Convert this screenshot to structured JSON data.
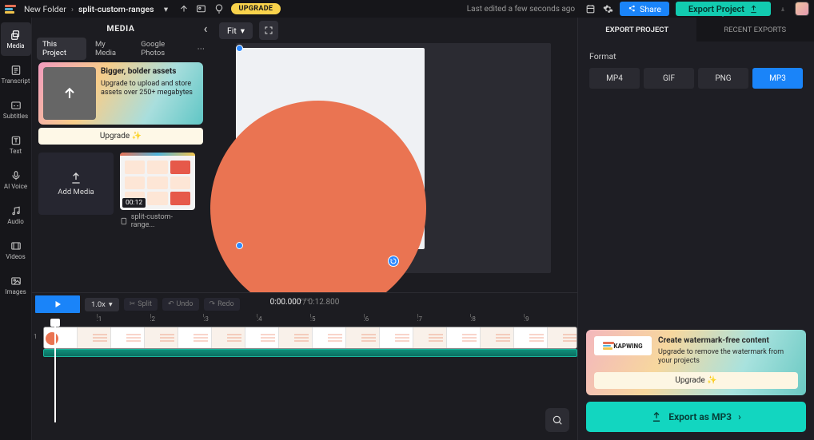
{
  "topbar": {
    "folder": "New Folder",
    "project": "split-custom-ranges",
    "upgrade": "UPGRADE",
    "last_edited": "Last edited a few seconds ago",
    "share": "Share",
    "export": "Export Project"
  },
  "leftnav": {
    "items": [
      {
        "label": "Media",
        "icon": "layers"
      },
      {
        "label": "Transcript",
        "icon": "transcript"
      },
      {
        "label": "Subtitles",
        "icon": "cc"
      },
      {
        "label": "Text",
        "icon": "text"
      },
      {
        "label": "AI Voice",
        "icon": "mic"
      },
      {
        "label": "Audio",
        "icon": "audio"
      },
      {
        "label": "Videos",
        "icon": "video"
      },
      {
        "label": "Images",
        "icon": "image"
      }
    ]
  },
  "media_panel": {
    "title": "MEDIA",
    "tabs": [
      "This Project",
      "My Media",
      "Google Photos"
    ],
    "active_tab": 0,
    "promo": {
      "title": "Bigger, bolder assets",
      "desc": "Upgrade to upload and store assets over 250+ megabytes",
      "cta": "Upgrade ✨"
    },
    "add_media": "Add Media",
    "clip": {
      "duration": "00:12",
      "name": "split-custom-range..."
    }
  },
  "canvas": {
    "fit": "Fit"
  },
  "timeline": {
    "zoom": "1.0x",
    "split": "Split",
    "undo": "Undo",
    "redo": "Redo",
    "current": "0:00.000",
    "total": "0:12.800",
    "ticks": [
      ":1",
      ":2",
      ":3",
      ":4",
      ":5",
      ":6",
      ":7",
      ":8",
      ":9"
    ],
    "track_label": "1"
  },
  "export_panel": {
    "tabs": [
      "EXPORT PROJECT",
      "RECENT EXPORTS"
    ],
    "active_tab": 0,
    "format_label": "Format",
    "formats": [
      "MP4",
      "GIF",
      "PNG",
      "MP3"
    ],
    "active_format": 3,
    "watermark": {
      "brand": "KAPWING",
      "title": "Create watermark-free content",
      "desc": "Upgrade to remove the watermark from your projects",
      "cta": "Upgrade ✨"
    },
    "action": "Export as MP3"
  }
}
